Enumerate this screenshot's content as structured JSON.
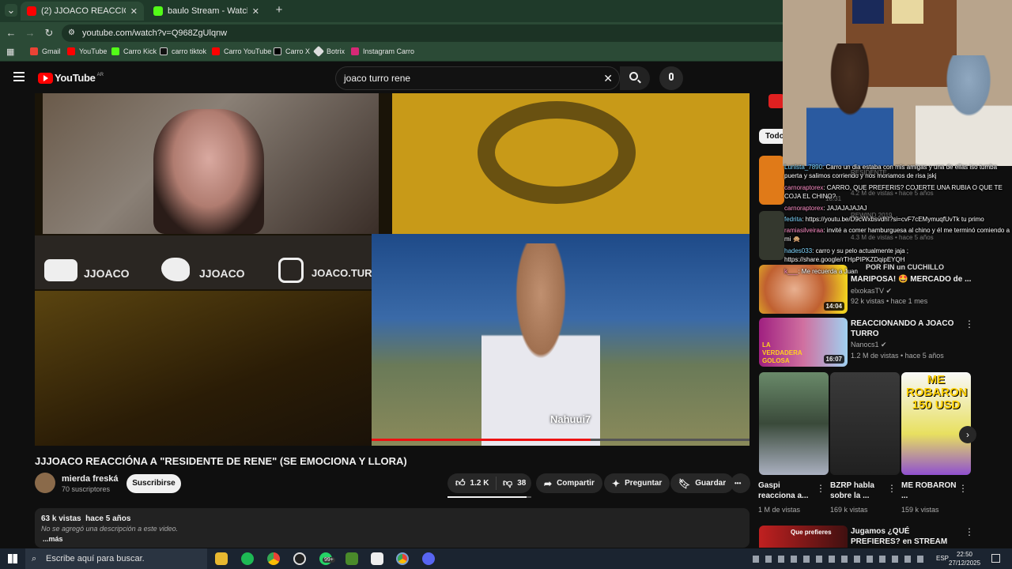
{
  "browser": {
    "tabs": [
      {
        "label": "(2) JJOACO REACCIÓNA A \"RE",
        "close": "✕",
        "active": true
      },
      {
        "label": "baulo Stream - Watch Live on K",
        "close": "✕",
        "active": false
      }
    ],
    "new_tab": "+",
    "url": "youtube.com/watch?v=Q968ZgUlqnw",
    "bookmarks": [
      "Gmail",
      "YouTube",
      "Carro Kick",
      "carro tiktok",
      "Carro YouTube",
      "Carro X",
      "Botrix",
      "Instagram Carro"
    ]
  },
  "youtube": {
    "logo": "YouTube",
    "region": "AR",
    "search_query": "joaco turro rene",
    "clear": "✕"
  },
  "player": {
    "social_labels": [
      "JJOACO",
      "JJOACO",
      "JOACO.TURRO"
    ],
    "subtitle": "Nahuui7",
    "progress": 0.58
  },
  "video": {
    "title": "JJJOACO REACCIÓNA A \"RESIDENTE DE RENE\" (SE EMOCIONA Y LLORA)",
    "channel": "mierda freská",
    "subscribers": "70 suscriptores",
    "subscribe_label": "Suscribirse",
    "likes": "1.2 K",
    "dislikes": "38",
    "share_label": "Compartir",
    "ask_label": "Preguntar",
    "save_label": "Guardar",
    "more": "•••",
    "views": "63 k vistas",
    "age": "hace 5 años",
    "description": "No se agregó una descripción a este video.",
    "more_label": "...más"
  },
  "sidebar": {
    "filter_chip": "Todo",
    "items": [
      {
        "title": "MARIPOSA! 🤩 MERCADO de ...",
        "channel": "elxokasTV",
        "meta": "92 k vistas • hace 1 mes",
        "duration": "14:04"
      },
      {
        "title": "REACCIONANDO A JOACO TURRO",
        "channel": "Nanocs1",
        "meta": "1.2 M de vistas • hace 5 años",
        "duration": "16:07",
        "thumb_text": "LA VERDADERA GOLOSA"
      }
    ],
    "shorts": [
      {
        "title": "Gaspi reacciona a...",
        "meta": "1 M de vistas"
      },
      {
        "title": "BZRP habla sobre la ...",
        "meta": "169 k vistas"
      },
      {
        "title": "ME ROBARON ...",
        "meta": "159 k vistas",
        "thumb_text": "ME ROBARON 150 USD"
      }
    ],
    "last": {
      "title": "Jugamos ¿QUÉ PREFIERES? en STREAM",
      "thumb_text": "Que prefieres"
    }
  },
  "chat": [
    {
      "user": "Lunista_7890",
      "msg": ": Carro un dia estaba con mis amigas y una de ellas iso tumba puerta y salimos corriendo y nos moriamos de risa jskj"
    },
    {
      "user": "carnoraptorex",
      "msg": ": CARRO, QUE PREFERIS? COJERTE UNA RUBIA O QUE TE COJA EL CHINO?"
    },
    {
      "user": "carnoraptorex",
      "msg": ": JAJAJAJAJAJ"
    },
    {
      "user": "fedrita",
      "msg": ": https://youtu.be/D9cWxbsvdhI?si=cvF7cEMymuqfUvTk tu primo"
    },
    {
      "user": "ramiasilveiraa",
      "msg": ": invité a comer hamburguesa al chino y él me terminó comiendo a mi 🙊"
    },
    {
      "user": "hades033",
      "msg": ": carro y su pelo actualmente jaja ; https://share.google/rTHpPIPKZDqipEYQH"
    },
    {
      "user": "k___",
      "msg": ": Me recuerda a Juan"
    }
  ],
  "chat_bg_text": [
    "POR FIN un CUCHILLO",
    "RESIDENTE",
    "4.2 M de vistas • hace 5 años",
    "4.3 M de vistas • hace 5 años",
    "18:31",
    "REWIND 2019"
  ],
  "taskbar": {
    "search_placeholder": "Escribe aquí para buscar.",
    "badge": "99+",
    "lang": "ESP",
    "time": "22:50",
    "date": "27/12/2025"
  },
  "colors": {
    "yt_bg": "#0f0f0f",
    "yt_red": "#ff0000",
    "chrome_green": "#2b4a36",
    "taskbar": "#1b2430"
  }
}
